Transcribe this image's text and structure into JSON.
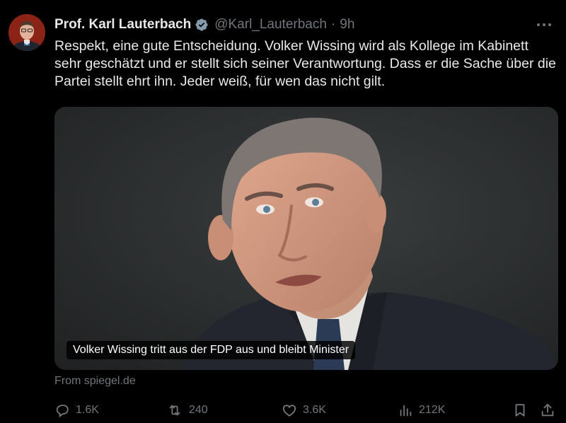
{
  "author": {
    "display_name": "Prof. Karl Lauterbach",
    "handle": "@Karl_Lauterbach",
    "separator": "·",
    "time": "9h",
    "verified_icon": "verified-badge-icon"
  },
  "tweet": {
    "text": "Respekt, eine gute Entscheidung. Volker Wissing wird als Kollege im Kabinett sehr geschätzt und er stellt sich seiner Verantwortung. Dass er die Sache über die Partei stellt ehrt ihn. Jeder weiß, für wen das nicht gilt."
  },
  "card": {
    "caption": "Volker Wissing tritt aus der FDP aus und bleibt Minister",
    "source": "From spiegel.de"
  },
  "actions": {
    "replies": "1.6K",
    "reposts": "240",
    "likes": "3.6K",
    "views": "212K"
  },
  "colors": {
    "background": "#000000",
    "text": "#e7e9ea",
    "muted": "#71767b",
    "verified": "#829aab"
  }
}
